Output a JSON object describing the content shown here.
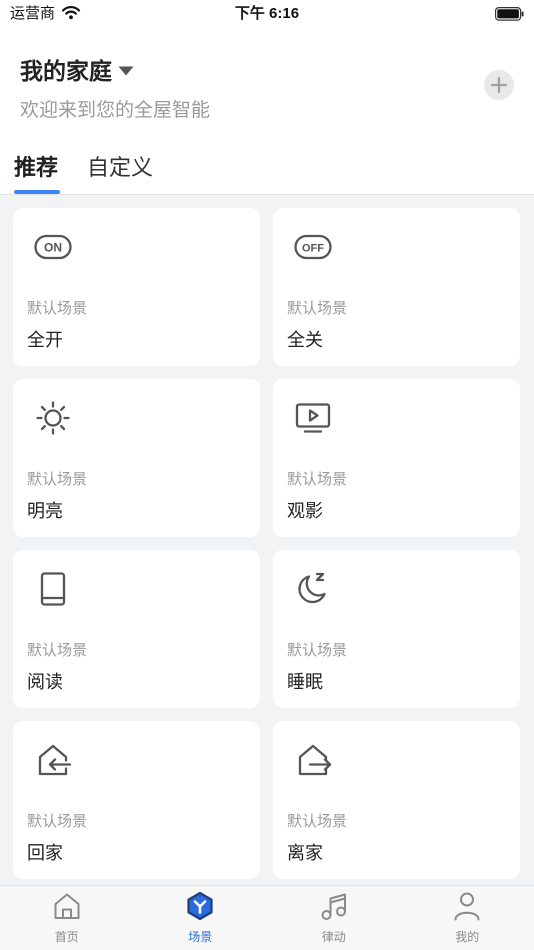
{
  "status_bar": {
    "carrier": "运营商",
    "time": "下午 6:16",
    "wifi_icon": "wifi-icon",
    "battery_icon": "battery-icon"
  },
  "header": {
    "title": "我的家庭",
    "subtitle": "欢迎来到您的全屋智能",
    "dropdown_icon": "caret-down-icon",
    "add_icon": "plus-icon"
  },
  "tabs": [
    {
      "label": "推荐",
      "active": true
    },
    {
      "label": "自定义",
      "active": false
    }
  ],
  "scenes": [
    {
      "icon": "power-on-icon",
      "icon_text": "ON",
      "category": "默认场景",
      "name": "全开"
    },
    {
      "icon": "power-off-icon",
      "icon_text": "OFF",
      "category": "默认场景",
      "name": "全关"
    },
    {
      "icon": "sun-icon",
      "category": "默认场景",
      "name": "明亮"
    },
    {
      "icon": "tv-play-icon",
      "category": "默认场景",
      "name": "观影"
    },
    {
      "icon": "book-icon",
      "category": "默认场景",
      "name": "阅读"
    },
    {
      "icon": "moon-sleep-icon",
      "category": "默认场景",
      "name": "睡眠"
    },
    {
      "icon": "home-enter-icon",
      "category": "默认场景",
      "name": "回家"
    },
    {
      "icon": "home-leave-icon",
      "category": "默认场景",
      "name": "离家"
    }
  ],
  "bottom_nav": [
    {
      "label": "首页",
      "icon": "home-icon",
      "active": false
    },
    {
      "label": "场景",
      "icon": "scene-hexagon-icon",
      "active": true
    },
    {
      "label": "律动",
      "icon": "music-note-icon",
      "active": false
    },
    {
      "label": "我的",
      "icon": "person-icon",
      "active": false
    }
  ],
  "colors": {
    "accent": "#3a86f5",
    "nav_active": "#2a6bd9",
    "background": "#f2f3f5",
    "card": "#ffffff",
    "text_primary": "#222222",
    "text_secondary": "#9a9a9a"
  }
}
